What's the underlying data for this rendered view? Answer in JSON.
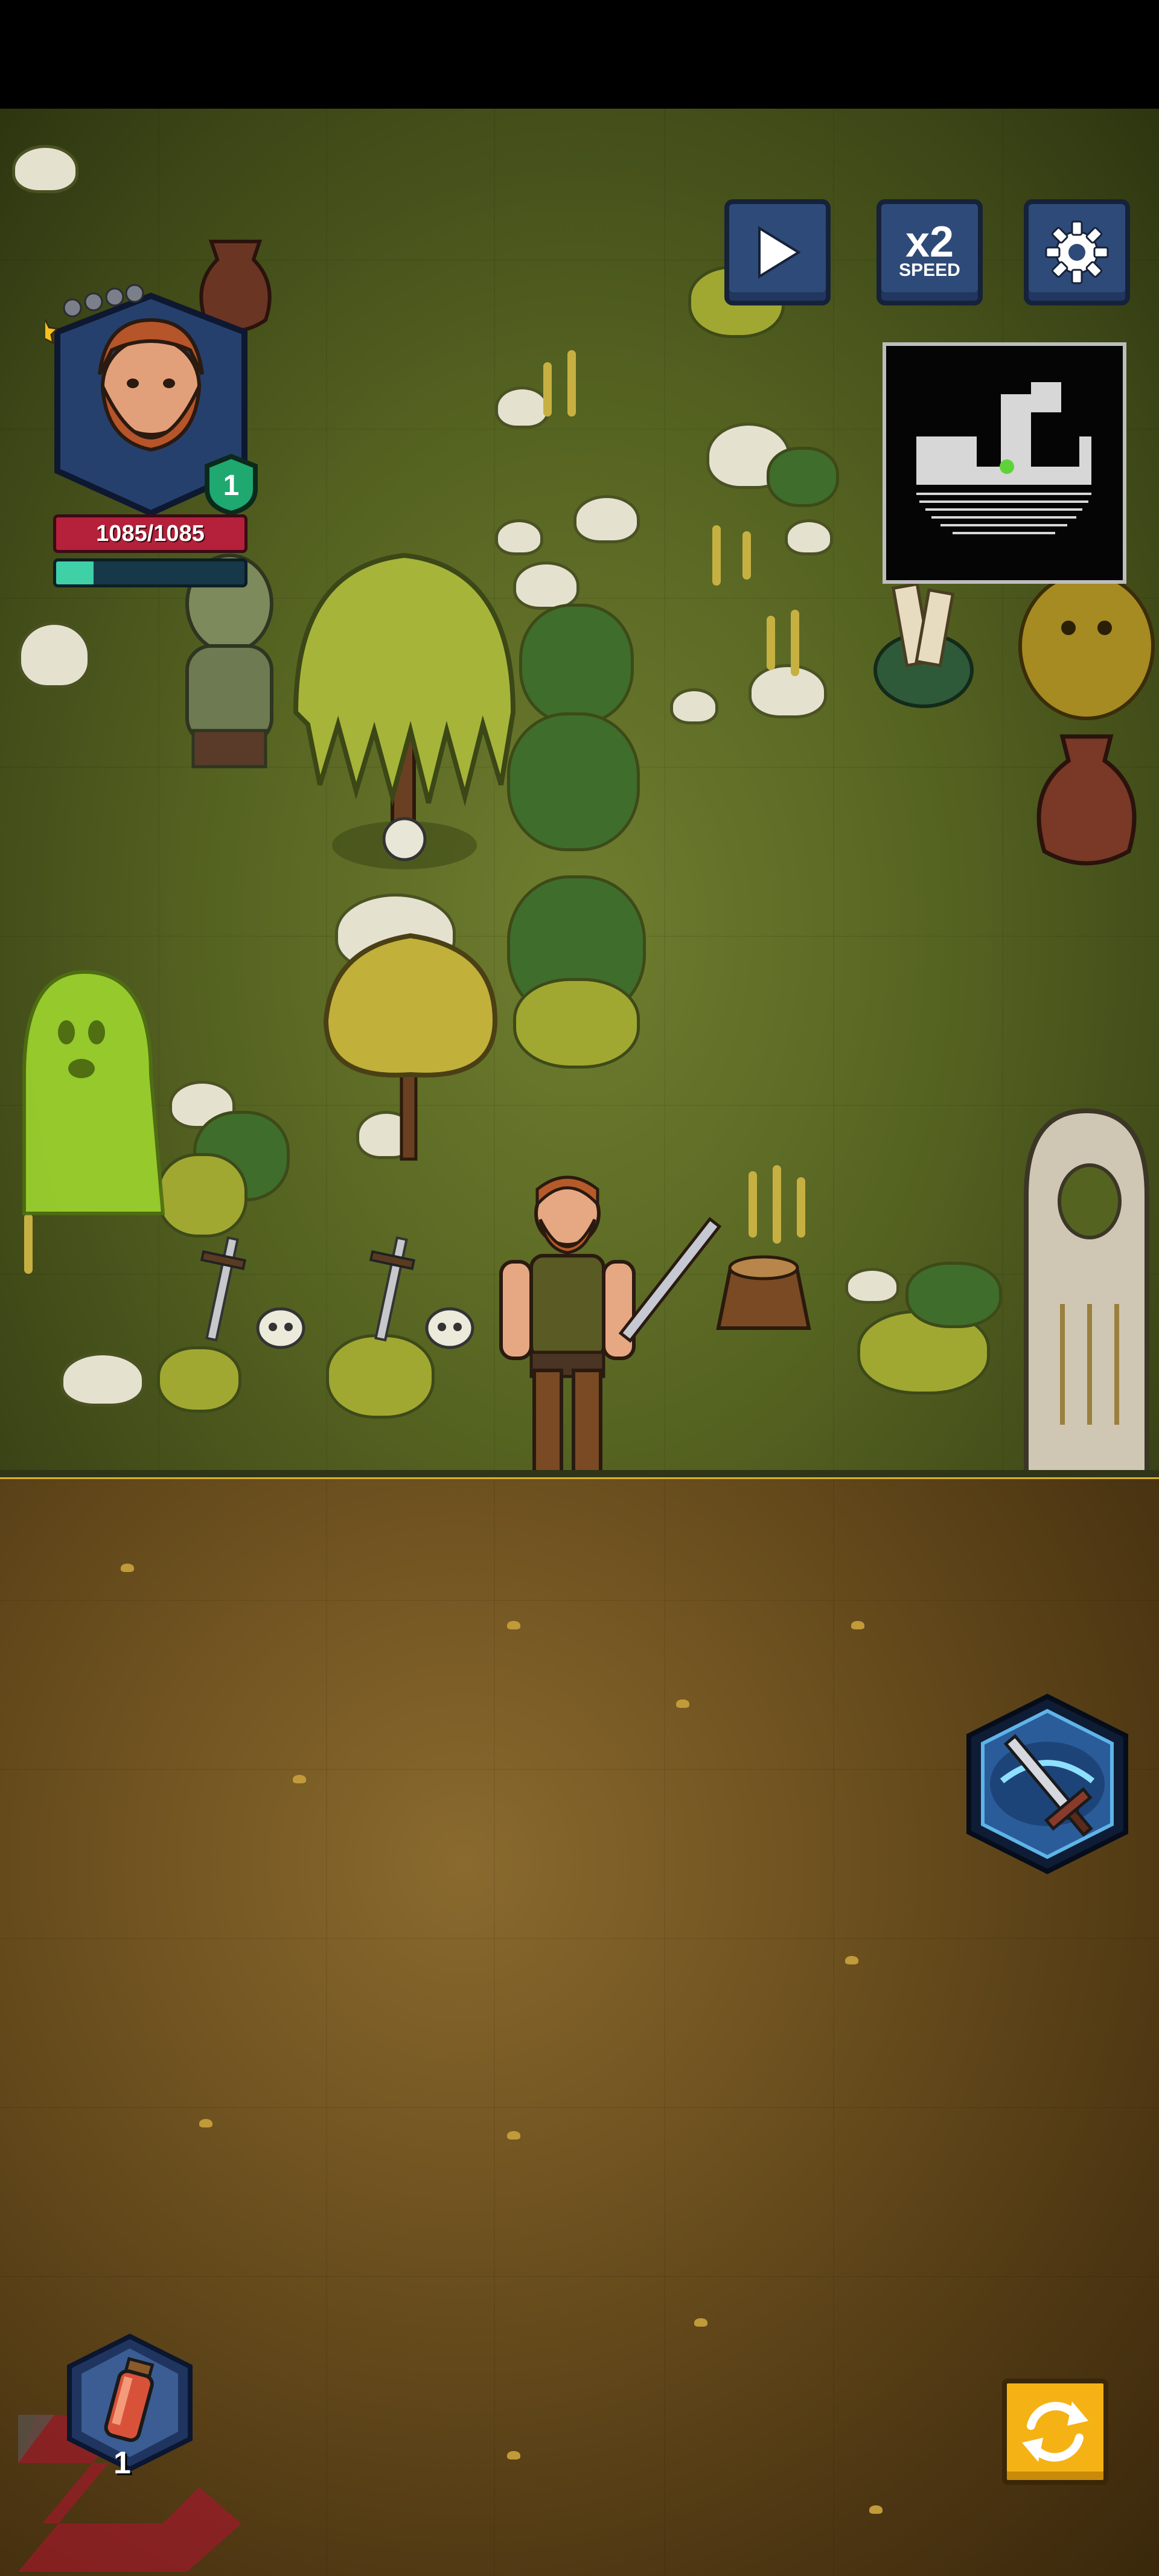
{
  "hero": {
    "hp_text": "1085/1085",
    "level": "1",
    "stars_filled": 1,
    "stars_total": 5,
    "xp_fraction": 0.2
  },
  "controls": {
    "play_icon": "play-icon",
    "speed_multiplier": "x2",
    "speed_label": "SPEED",
    "settings_icon": "gear-icon"
  },
  "inventory": {
    "potion_count": "1"
  },
  "colors": {
    "hp": "#b5203a",
    "xp": "#3fd0a8",
    "button_blue": "#2e4a78",
    "refresh_yellow": "#f5b214"
  }
}
